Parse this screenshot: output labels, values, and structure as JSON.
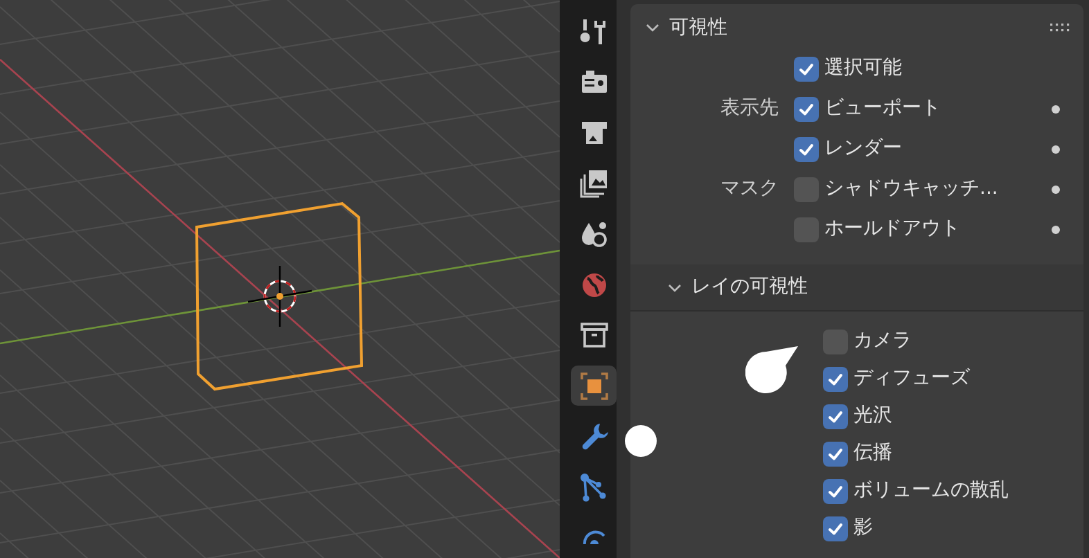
{
  "property_tabs": [
    {
      "selected": false
    },
    {
      "selected": false
    },
    {
      "selected": false
    },
    {
      "selected": false
    },
    {
      "selected": false
    },
    {
      "selected": false
    },
    {
      "selected": false
    },
    {
      "selected": true
    },
    {
      "selected": false
    },
    {
      "selected": false
    },
    {
      "selected": false
    }
  ],
  "visibility_panel": {
    "title": "可視性",
    "expanded": true,
    "rows": [
      {
        "label": "",
        "text": "選択可能",
        "checked": true,
        "keyframe_dot": false
      },
      {
        "label": "表示先",
        "text": "ビューポート",
        "checked": true,
        "keyframe_dot": true
      },
      {
        "label": "",
        "text": "レンダー",
        "checked": true,
        "keyframe_dot": true
      },
      {
        "label": "マスク",
        "text": "シャドウキャッチ...",
        "checked": false,
        "keyframe_dot": true
      },
      {
        "label": "",
        "text": "ホールドアウト",
        "checked": false,
        "keyframe_dot": true
      }
    ]
  },
  "ray_visibility_panel": {
    "title": "レイの可視性",
    "expanded": true,
    "rows": [
      {
        "text": "カメラ",
        "checked": false
      },
      {
        "text": "ディフューズ",
        "checked": true
      },
      {
        "text": "光沢",
        "checked": true
      },
      {
        "text": "伝播",
        "checked": true
      },
      {
        "text": "ボリュームの散乱",
        "checked": true
      },
      {
        "text": "影",
        "checked": true
      }
    ]
  }
}
